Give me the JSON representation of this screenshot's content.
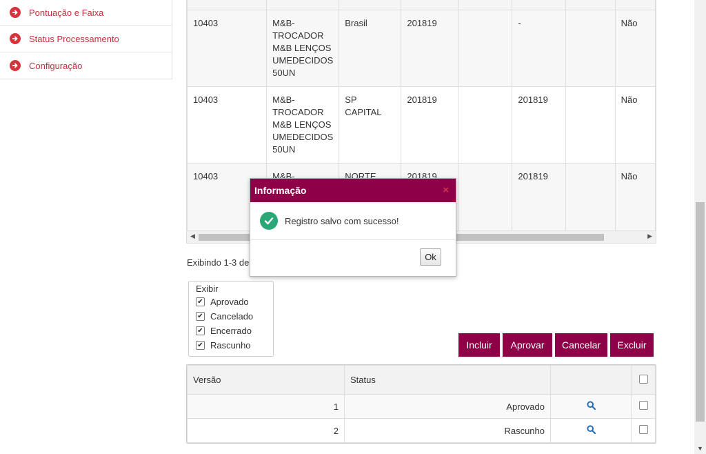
{
  "sidebar": {
    "items": [
      {
        "label": "Pontuação e Faixa"
      },
      {
        "label": "Status Processamento"
      },
      {
        "label": "Configuração"
      }
    ]
  },
  "grid": {
    "rows": [
      {
        "code": "10403",
        "product": "M&B-\nTROCADOR\nM&B LENÇOS\nUMEDECIDOS\n50UN",
        "region": "Brasil",
        "cycle": "201819",
        "empty": "",
        "cycle_end": "-",
        "blank": "",
        "flag": "Não"
      },
      {
        "code": "10403",
        "product": "M&B-\nTROCADOR\nM&B LENÇOS\nUMEDECIDOS\n50UN",
        "region": "SP CAPITAL",
        "cycle": "201819",
        "empty": "",
        "cycle_end": "201819",
        "blank": "",
        "flag": "Não"
      },
      {
        "code": "10403",
        "product": "M&B-",
        "region": "NORTE",
        "cycle": "201819",
        "empty": "",
        "cycle_end": "201819",
        "blank": "",
        "flag": "Não"
      }
    ]
  },
  "pager": {
    "showing": "Exibindo 1-3 de"
  },
  "filter": {
    "legend": "Exibir",
    "options": [
      {
        "label": "Aprovado",
        "checked": true
      },
      {
        "label": "Cancelado",
        "checked": true
      },
      {
        "label": "Encerrado",
        "checked": true
      },
      {
        "label": "Rascunho",
        "checked": true
      }
    ]
  },
  "actions": {
    "include": "Incluir",
    "approve": "Aprovar",
    "cancel": "Cancelar",
    "delete": "Excluir"
  },
  "versions": {
    "headers": {
      "version": "Versão",
      "status": "Status"
    },
    "rows": [
      {
        "version": "1",
        "status": "Aprovado"
      },
      {
        "version": "2",
        "status": "Rascunho"
      }
    ]
  },
  "modal": {
    "title": "Informação",
    "close": "×",
    "message": "Registro salvo com sucesso!",
    "ok": "Ok"
  },
  "colors": {
    "brand": "#8e0048",
    "sidebar_accent": "#d6343c",
    "success": "#2aa876",
    "link": "#2a6ebb"
  },
  "icons": {
    "sidebar": "arrow-circle-right-icon",
    "success": "check-circle-icon",
    "row_action": "search-icon"
  }
}
